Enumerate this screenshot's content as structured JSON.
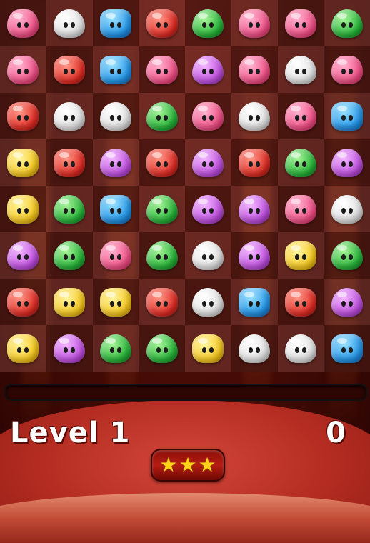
{
  "hud": {
    "level_label": "Level 1",
    "score": "0",
    "progress_fraction": 0,
    "stars": {
      "earned": 3,
      "total": 3,
      "symbol": "★",
      "color": "#ffd21a"
    }
  },
  "board": {
    "rows": 8,
    "cols": 8,
    "cells": [
      [
        "pink",
        "white",
        "blue",
        "red",
        "green",
        "pink",
        "pink",
        "green"
      ],
      [
        "pink",
        "red",
        "blue",
        "pink",
        "purple",
        "pink",
        "white",
        "pink"
      ],
      [
        "red",
        "white",
        "white",
        "green",
        "pink",
        "white",
        "pink",
        "blue"
      ],
      [
        "yellow",
        "red",
        "purple",
        "red",
        "purple",
        "red",
        "green",
        "purple"
      ],
      [
        "yellow",
        "green",
        "blue",
        "green",
        "purple",
        "purple",
        "pink",
        "white"
      ],
      [
        "purple",
        "green",
        "pink",
        "green",
        "white",
        "purple",
        "yellow",
        "green"
      ],
      [
        "red",
        "yellow",
        "yellow",
        "red",
        "white",
        "blue",
        "red",
        "purple"
      ],
      [
        "yellow",
        "purple",
        "green",
        "green",
        "yellow",
        "white",
        "white",
        "blue"
      ]
    ]
  },
  "piece_colors": {
    "pink": "#f0467f",
    "white": "#e2e2e2",
    "blue": "#2496e8",
    "red": "#e02a22",
    "green": "#23b336",
    "purple": "#c04ee0",
    "yellow": "#f7c81c"
  }
}
